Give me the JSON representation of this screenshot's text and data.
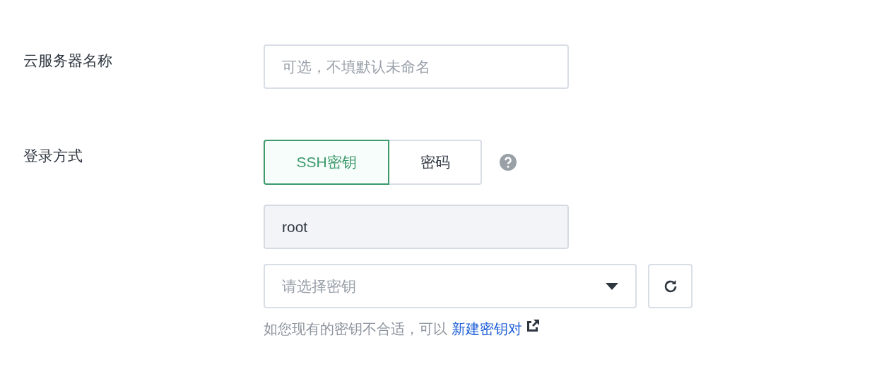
{
  "server_name": {
    "label": "云服务器名称",
    "placeholder": "可选，不填默认未命名"
  },
  "login": {
    "label": "登录方式",
    "methods": [
      {
        "label": "SSH密钥",
        "selected": true
      },
      {
        "label": "密码",
        "selected": false
      }
    ],
    "username": {
      "value": "root",
      "disabled": true
    },
    "key_select": {
      "placeholder": "请选择密钥"
    },
    "hint": {
      "text": "如您现有的密钥不合适，可以",
      "link": "新建密钥对"
    }
  }
}
